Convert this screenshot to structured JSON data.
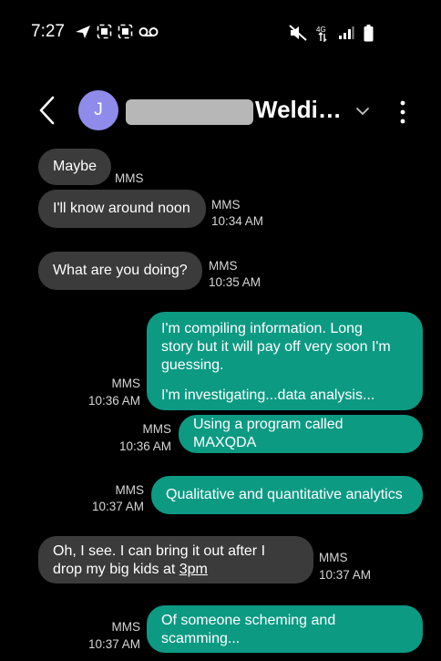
{
  "status_bar": {
    "time": "7:27",
    "icons_left": [
      "send-icon",
      "screenshot-icon",
      "screenshot-icon",
      "voicemail-icon"
    ],
    "icons_right": [
      "mute-icon",
      "data-icon",
      "signal-icon",
      "battery-icon"
    ]
  },
  "header": {
    "avatar_initial": "J",
    "contact_name": "Weldi…",
    "icons": [
      "back-arrow-icon",
      "chevron-down-icon",
      "more-vert-icon"
    ]
  },
  "messages": [
    {
      "direction": "in",
      "text": "Maybe",
      "meta1": "MMS",
      "meta2": ""
    },
    {
      "direction": "in",
      "text": "I'll know around noon",
      "meta1": "MMS",
      "meta2": "10:34 AM"
    },
    {
      "direction": "in",
      "text": "What are you doing?",
      "meta1": "MMS",
      "meta2": "10:35 AM"
    },
    {
      "direction": "out",
      "line1": "I'm compiling information. Long",
      "line2": "story but it will pay off very soon I'm",
      "line3": "guessing.",
      "line4": "I'm investigating...data analysis...",
      "meta1": "MMS",
      "meta2": "10:36 AM"
    },
    {
      "direction": "out",
      "text": "Using a program called MAXQDA",
      "meta1": "MMS",
      "meta2": "10:36 AM"
    },
    {
      "direction": "out",
      "text": "Qualitative and quantitative analytics",
      "meta1": "MMS",
      "meta2": "10:37 AM"
    },
    {
      "direction": "in",
      "line1": "Oh, I see.  I can bring it out after I",
      "line2_prefix": "drop my big kids at ",
      "line2_link": "3pm",
      "meta1": "MMS",
      "meta2": "10:37 AM"
    },
    {
      "direction": "out",
      "line1": "Of someone scheming and",
      "line2": "scamming...",
      "meta1": "MMS",
      "meta2": "10:37 AM"
    }
  ],
  "colors": {
    "background": "#000000",
    "incoming_bubble": "#3b3b3b",
    "outgoing_bubble": "#0c9a83",
    "avatar": "#8f8bea"
  }
}
